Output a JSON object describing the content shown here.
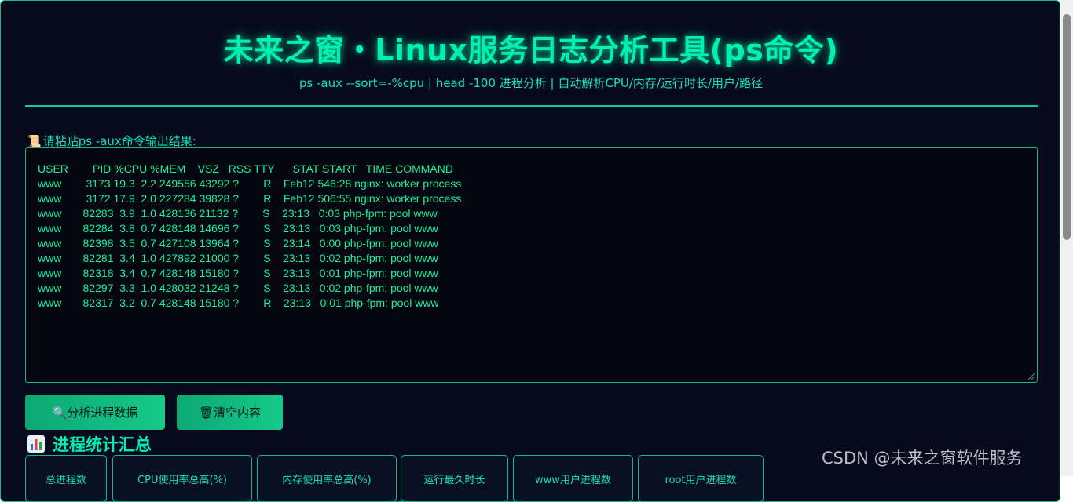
{
  "header": {
    "title": "未来之窗・Linux服务日志分析工具(ps命令)",
    "subtitle": "ps -aux --sort=-%cpu | head -100 进程分析 | 自动解析CPU/内存/运行时长/用户/路径"
  },
  "input": {
    "label_icon": "scroll-icon",
    "label": "请粘贴ps -aux命令输出结果:",
    "value": "USER        PID %CPU %MEM    VSZ   RSS TTY      STAT START   TIME COMMAND\nwww        3173 19.3  2.2 249556 43292 ?        R    Feb12 546:28 nginx: worker process\nwww        3172 17.9  2.0 227284 39828 ?        R    Feb12 506:55 nginx: worker process\nwww       82283  3.9  1.0 428136 21132 ?        S    23:13   0:03 php-fpm: pool www\nwww       82284  3.8  0.7 428148 14696 ?        S    23:13   0:03 php-fpm: pool www\nwww       82398  3.5  0.7 427108 13964 ?        S    23:14   0:00 php-fpm: pool www\nwww       82281  3.4  1.0 427892 21000 ?        S    23:13   0:02 php-fpm: pool www\nwww       82318  3.4  0.7 428148 15180 ?        S    23:13   0:01 php-fpm: pool www\nwww       82297  3.3  1.0 428032 21248 ?        S    23:13   0:02 php-fpm: pool www\nwww       82317  3.2  0.7 428148 15180 ?        R    23:13   0:01 php-fpm: pool www"
  },
  "buttons": {
    "analyze_icon": "magnifier-icon",
    "analyze_label": "分析进程数据",
    "clear_icon": "trash-icon",
    "clear_label": "清空内容"
  },
  "stats": {
    "heading_icon": "bar-chart-icon",
    "heading": "进程统计汇总",
    "cards": [
      {
        "label": "总进程数"
      },
      {
        "label": "CPU使用率总高(%)"
      },
      {
        "label": "内存使用率总高(%)"
      },
      {
        "label": "运行最久时长"
      },
      {
        "label": "www用户进程数"
      },
      {
        "label": "root用户进程数"
      }
    ]
  },
  "watermark": "CSDN @未来之窗软件服务",
  "colors": {
    "background": "#070a1c",
    "accent": "#00f0b0",
    "border": "#12b886",
    "button": "#16c98a"
  }
}
